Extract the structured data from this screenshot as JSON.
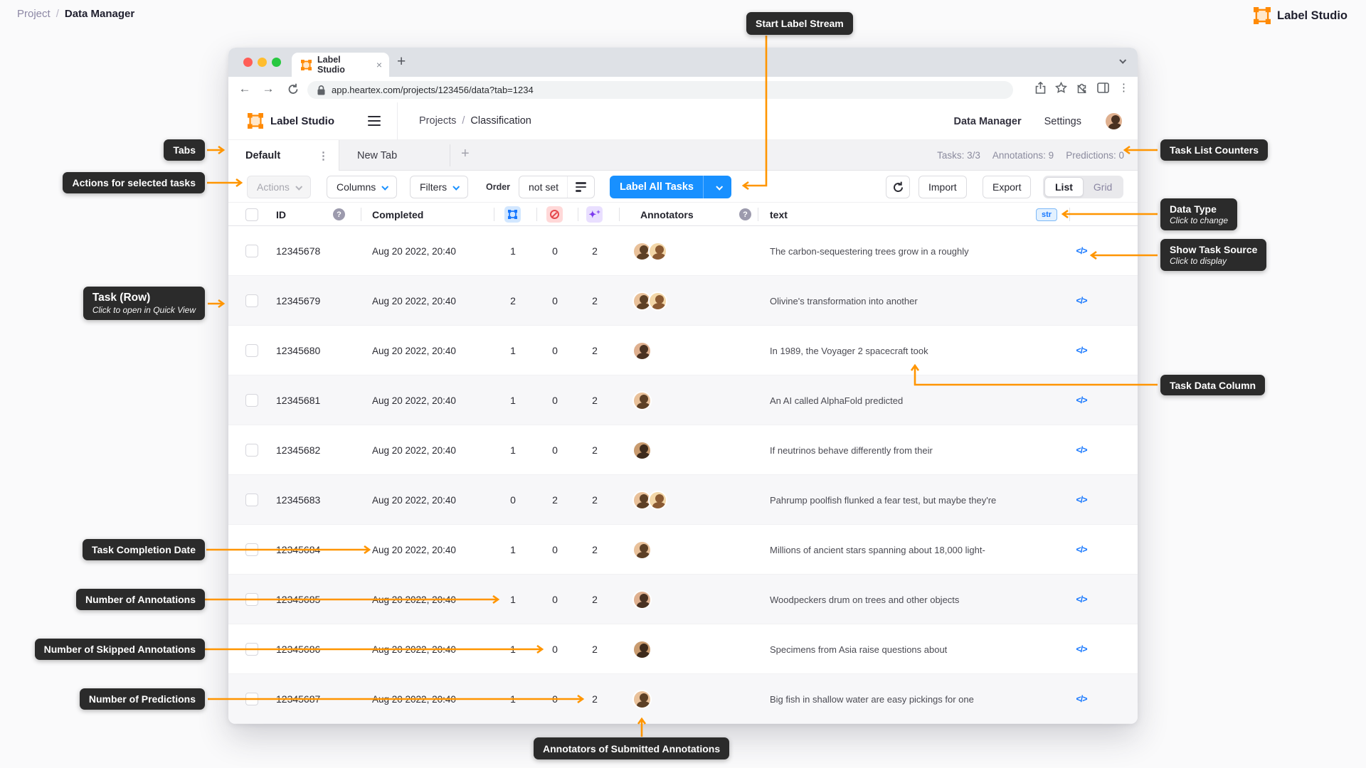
{
  "colors": {
    "accent_blue": "#1890FF",
    "brand_orange": "#FF8A05",
    "arrow_orange": "#FF9500",
    "callout_bg": "#2B2B2B",
    "str_badge_blue": "#1677FF",
    "skipped_red": "#E5484D",
    "predictions_purple": "#7C3AED"
  },
  "page": {
    "breadcrumb_parent": "Project",
    "breadcrumb_sep": "/",
    "breadcrumb_current": "Data Manager",
    "brand": "Label Studio"
  },
  "browser": {
    "tab_title": "Label Studio",
    "close_glyph": "×",
    "new_tab_glyph": "+",
    "url": "app.heartex.com/projects/123456/data?tab=1234",
    "back_glyph": "←",
    "forward_glyph": "→",
    "kebab_glyph": "⋮"
  },
  "app": {
    "logo_text": "Label Studio",
    "crumb_parent": "Projects",
    "crumb_sep": "/",
    "crumb_current": "Classification",
    "nav_data_manager": "Data Manager",
    "nav_settings": "Settings",
    "tab_default": "Default",
    "tab_kebab": "⋮",
    "tab_new": "New Tab",
    "tab_add": "+",
    "counters": {
      "tasks": "Tasks: 3/3",
      "annotations": "Annotations: 9",
      "predictions": "Predictions: 0"
    },
    "toolbar": {
      "actions": "Actions",
      "columns": "Columns",
      "filters": "Filters",
      "order_label": "Order",
      "order_value": "not set",
      "label_all": "Label All Tasks",
      "import": "Import",
      "export": "Export",
      "list": "List",
      "grid": "Grid"
    },
    "table": {
      "headers": {
        "id": "ID",
        "help_glyph": "?",
        "completed": "Completed",
        "annotators": "Annotators",
        "text": "text",
        "data_type": "str"
      },
      "code_icon": "</>",
      "sparkles_glyph": "✦",
      "sparkles_plus": "+",
      "rows": [
        {
          "id": "12345678",
          "completed": "Aug 20 2022, 20:40",
          "annotations": "1",
          "skipped": "0",
          "predictions": "2",
          "avatars": [
            "m",
            "f"
          ],
          "text": "The carbon-sequestering trees grow in a roughly"
        },
        {
          "id": "12345679",
          "completed": "Aug 20 2022, 20:40",
          "annotations": "2",
          "skipped": "0",
          "predictions": "2",
          "avatars": [
            "m",
            "f"
          ],
          "text": "Olivine's transformation into another"
        },
        {
          "id": "12345680",
          "completed": "Aug 20 2022, 20:40",
          "annotations": "1",
          "skipped": "0",
          "predictions": "2",
          "avatars": [
            "w"
          ],
          "text": "In 1989, the Voyager 2 spacecraft took"
        },
        {
          "id": "12345681",
          "completed": "Aug 20 2022, 20:40",
          "annotations": "1",
          "skipped": "0",
          "predictions": "2",
          "avatars": [
            "m"
          ],
          "text": "An AI called AlphaFold predicted"
        },
        {
          "id": "12345682",
          "completed": "Aug 20 2022, 20:40",
          "annotations": "1",
          "skipped": "0",
          "predictions": "2",
          "avatars": [
            "m2"
          ],
          "text": "If neutrinos behave differently from their"
        },
        {
          "id": "12345683",
          "completed": "Aug 20 2022, 20:40",
          "annotations": "0",
          "skipped": "2",
          "predictions": "2",
          "avatars": [
            "m",
            "f"
          ],
          "text": "Pahrump poolfish flunked a fear test, but maybe they're"
        },
        {
          "id": "12345684",
          "completed": "Aug 20 2022, 20:40",
          "annotations": "1",
          "skipped": "0",
          "predictions": "2",
          "avatars": [
            "m"
          ],
          "text": "Millions of ancient stars spanning about 18,000 light-"
        },
        {
          "id": "12345685",
          "completed": "Aug 20 2022, 20:40",
          "annotations": "1",
          "skipped": "0",
          "predictions": "2",
          "avatars": [
            "w"
          ],
          "text": "Woodpeckers drum on trees and other objects"
        },
        {
          "id": "12345686",
          "completed": "Aug 20 2022, 20:40",
          "annotations": "1",
          "skipped": "0",
          "predictions": "2",
          "avatars": [
            "m2"
          ],
          "text": "Specimens from Asia raise questions about"
        },
        {
          "id": "12345687",
          "completed": "Aug 20 2022, 20:40",
          "annotations": "1",
          "skipped": "0",
          "predictions": "2",
          "avatars": [
            "m"
          ],
          "text": "Big fish in shallow water are easy pickings for one"
        }
      ]
    }
  },
  "callouts": {
    "start_label_stream": {
      "title": "Start Label Stream"
    },
    "tabs": {
      "title": "Tabs"
    },
    "actions": {
      "title": "Actions for selected tasks"
    },
    "task_list_counters": {
      "title": "Task List Counters"
    },
    "data_type": {
      "title": "Data Type",
      "subtitle": "Click to change"
    },
    "show_task_source": {
      "title": "Show Task Source",
      "subtitle": "Click to display"
    },
    "task_row": {
      "title": "Task (Row)",
      "subtitle": "Click to open in Quick View"
    },
    "task_data_column": {
      "title": "Task Data Column"
    },
    "task_completion_date": {
      "title": "Task Completion Date"
    },
    "number_of_annotations": {
      "title": "Number of Annotations"
    },
    "number_of_skipped": {
      "title": "Number of Skipped Annotations"
    },
    "number_of_predictions": {
      "title": "Number of Predictions"
    },
    "annotators_submitted": {
      "title": "Annotators of Submitted Annotations"
    }
  }
}
